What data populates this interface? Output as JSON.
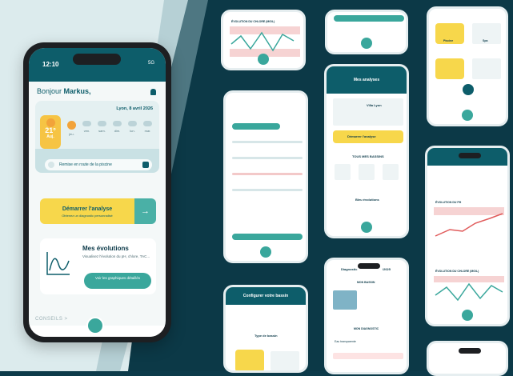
{
  "main": {
    "status_time": "12:10",
    "status_net": "5G",
    "greeting_prefix": "Bonjour",
    "greeting_name": "Markus,",
    "weather": {
      "location_date": "Lyon, 8 avril 2026",
      "today_temp": "21°",
      "today_label": "Auj.",
      "days": [
        "jeu.",
        "ven.",
        "sam.",
        "dim.",
        "lun.",
        "mar."
      ]
    },
    "remise_label": "Remise en route de la piscine",
    "cta_title": "Démarrer l'analyse",
    "cta_subtitle": "Obtenez un diagnostic personnalisé",
    "evo_title": "Mes évolutions",
    "evo_desc": "Visualisez l'évolution du pH, chlore, TAC...",
    "evo_button": "Voir les graphiques détaillés",
    "conseils": "CONSEILS  >"
  },
  "minis": {
    "chlore_chart": "ÉVOLUTION DU CHLORE (MG/L)",
    "analyses_title": "Mes analyses",
    "pool_name": "Villa Lyon",
    "analyse_btn": "Démarrer l'analyse",
    "tous_bassins": "TOUS MES BASSINS",
    "bleu_evo": "Bleu évolutions",
    "diag_title": "Diagnostic",
    "diag_year": "/2025",
    "mon_bassin": "MON BASSIN",
    "mon_diag": "MON DIAGNOSTIC",
    "eau_trans": "Eau transparente",
    "config_title": "Configurer votre bassin",
    "type_bassin": "Type de bassin",
    "evo_ph": "ÉVOLUTION DU PH",
    "evo_chlore": "ÉVOLUTION DU CHLORE (MG/L)",
    "piscine": "Piscine",
    "spa": "Spa"
  },
  "colors": {
    "primary": "#0d5d6a",
    "accent": "#3aa79c",
    "yellow": "#f7d74b",
    "background": "#0c3947"
  }
}
